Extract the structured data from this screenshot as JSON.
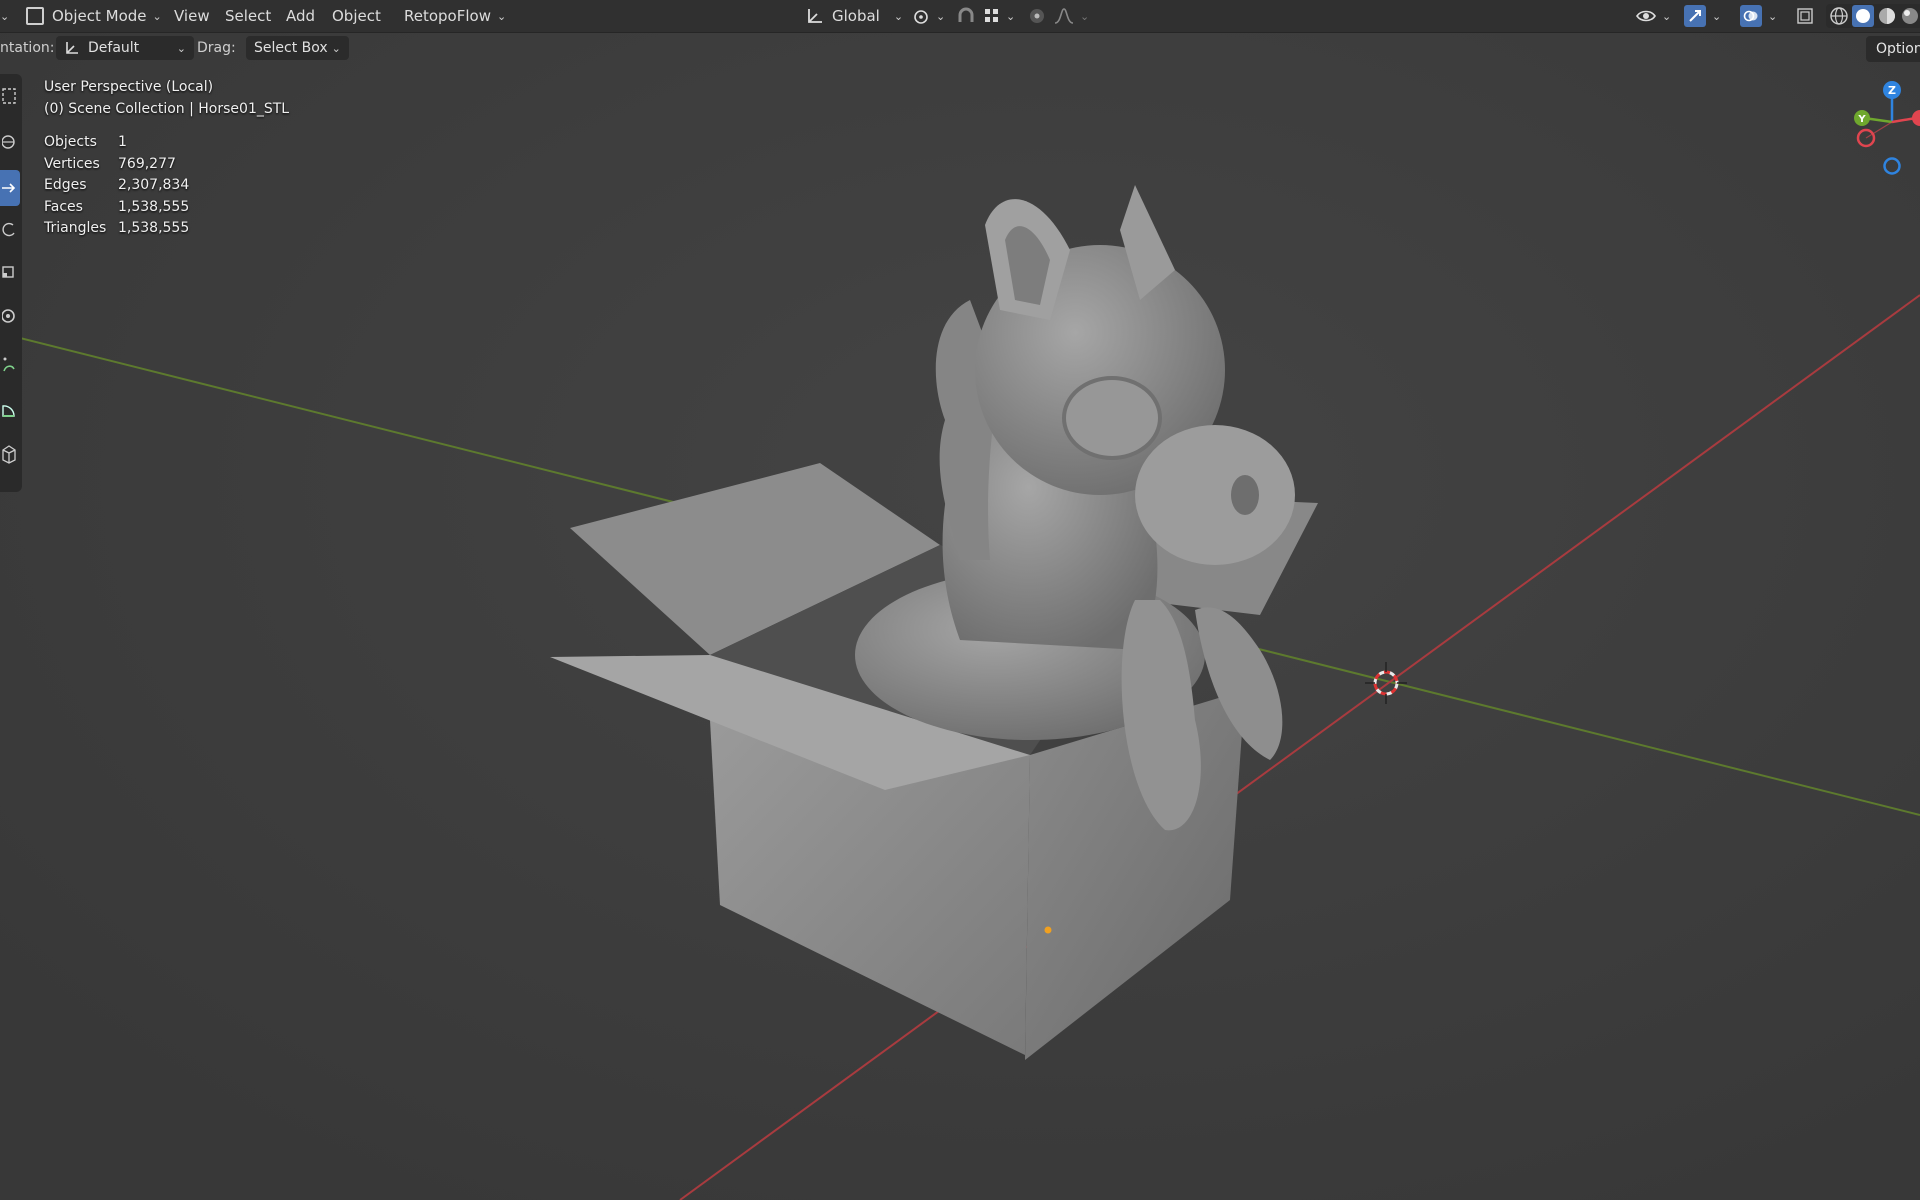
{
  "header": {
    "mode": "Object Mode",
    "menus": [
      "View",
      "Select",
      "Add",
      "Object"
    ],
    "addon": "RetopoFlow",
    "transform_orientation": "Global"
  },
  "tool_header": {
    "orientation_label": "ntation:",
    "orientation_value": "Default",
    "drag_label": "Drag:",
    "drag_value": "Select Box",
    "options_label": "Option"
  },
  "viewport": {
    "perspective": "User Perspective (Local)",
    "collection": "(0) Scene Collection | Horse01_STL",
    "stats": [
      {
        "label": "Objects",
        "value": "1"
      },
      {
        "label": "Vertices",
        "value": "769,277"
      },
      {
        "label": "Edges",
        "value": "2,307,834"
      },
      {
        "label": "Faces",
        "value": "1,538,555"
      },
      {
        "label": "Triangles",
        "value": "1,538,555"
      }
    ]
  },
  "gizmo": {
    "z": "Z",
    "y": "Y",
    "x": "X",
    "colors": {
      "x": "#e0454f",
      "y": "#6fa82e",
      "z": "#2f84e0"
    }
  },
  "icons": [
    "select-box-icon",
    "cursor-icon",
    "move-icon",
    "rotate-icon",
    "scale-icon",
    "transform-icon",
    "annotate-icon",
    "measure-icon",
    "add-cube-icon"
  ]
}
